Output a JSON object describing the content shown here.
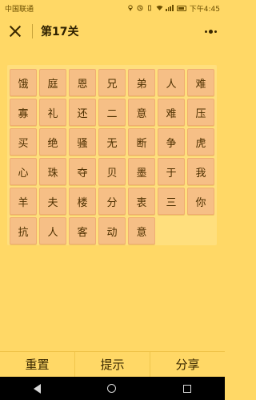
{
  "status_bar": {
    "carrier": "中国联通",
    "time": "下午4:45"
  },
  "header": {
    "title": "第17关"
  },
  "tiles": [
    "饿",
    "庭",
    "恩",
    "兄",
    "弟",
    "人",
    "难",
    "寡",
    "礼",
    "还",
    "二",
    "意",
    "难",
    "压",
    "买",
    "绝",
    "骚",
    "无",
    "断",
    "争",
    "虎",
    "心",
    "珠",
    "夺",
    "贝",
    "墨",
    "于",
    "我",
    "羊",
    "夫",
    "楼",
    "分",
    "衷",
    "三",
    "你",
    "抗",
    "人",
    "客",
    "动",
    "意"
  ],
  "bottom_bar": {
    "reset_label": "重置",
    "hint_label": "提示",
    "share_label": "分享"
  },
  "colors": {
    "background": "#ffd866",
    "tile": "#f6bf86",
    "board": "#ffdf7d"
  }
}
